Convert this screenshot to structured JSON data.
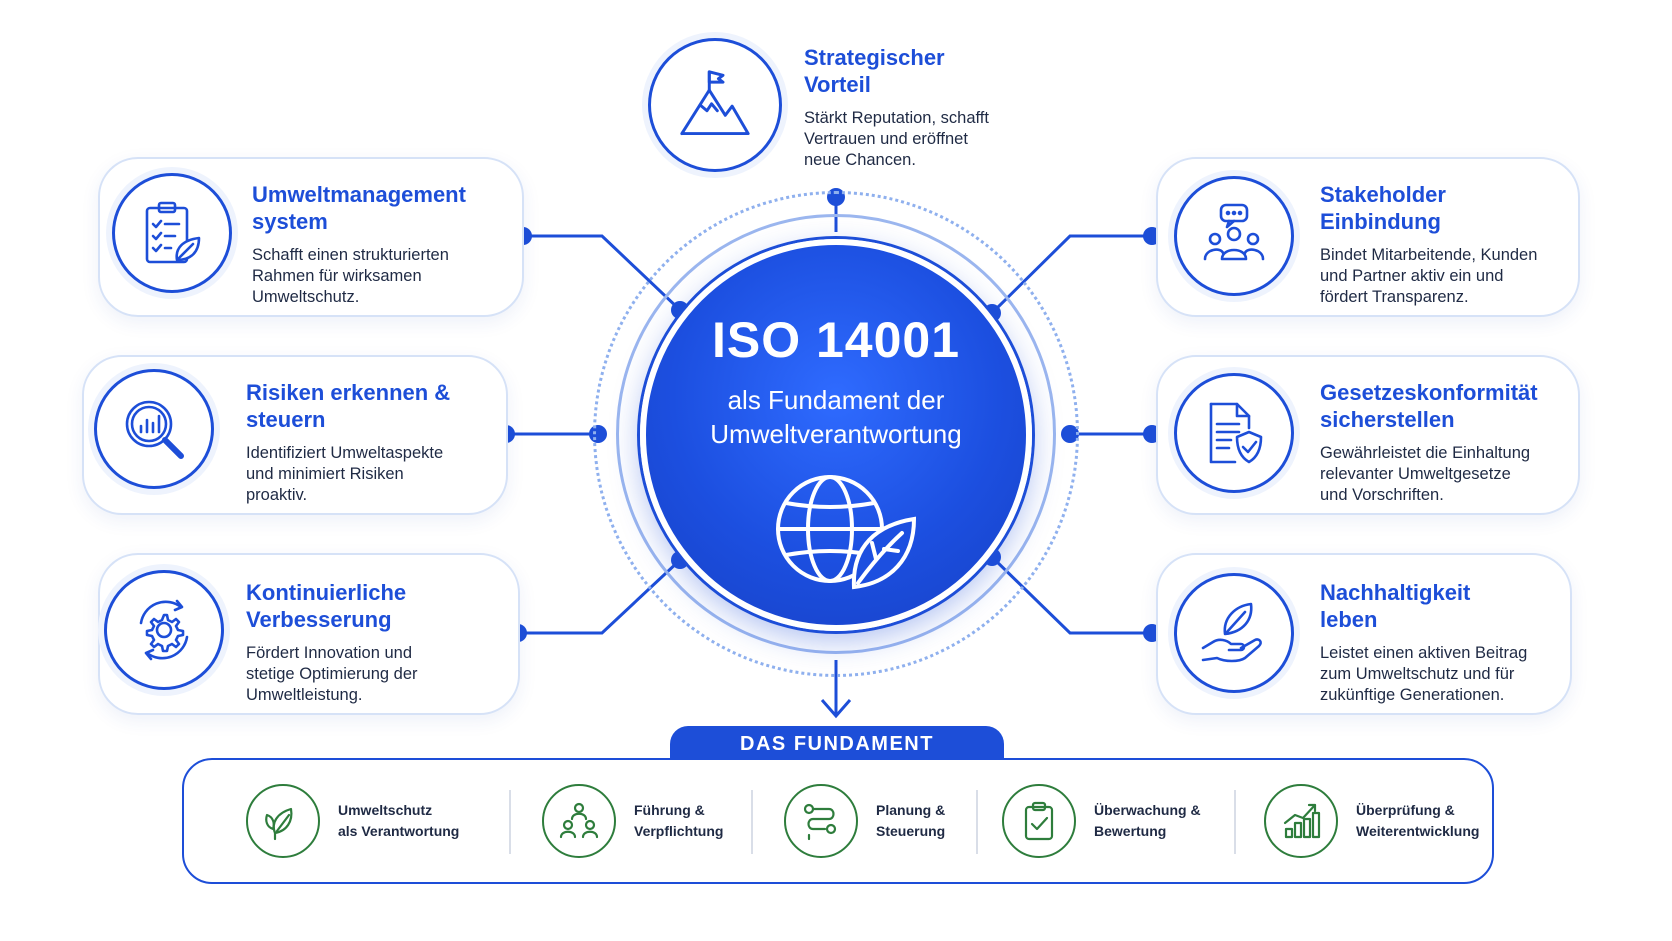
{
  "center": {
    "title": "ISO 14001",
    "subtitle": "als Fundament der\nUmweltverantwortung",
    "icon": "globe-leaf-icon"
  },
  "cards": {
    "strategic": {
      "title": "Strategischer\nVorteil",
      "desc": "Stärkt Reputation, schafft\nVertrauen und eröffnet\nneue Chancen.",
      "icon": "mountain-flag-icon"
    },
    "ems": {
      "title": "Umweltmanagement\nsystem",
      "desc": "Schafft einen strukturierten\nRahmen für wirksamen\nUmweltschutz.",
      "icon": "checklist-leaf-icon"
    },
    "risk": {
      "title": "Risiken erkennen &\nsteuern",
      "desc": "Identifiziert Umweltaspekte\nund minimiert Risiken\nproaktiv.",
      "icon": "magnifier-chart-icon"
    },
    "improvement": {
      "title": "Kontinuierliche\nVerbesserung",
      "desc": "Fördert Innovation und\nstetige Optimierung der\nUmweltleistung.",
      "icon": "gear-cycle-icon"
    },
    "stakeholder": {
      "title": "Stakeholder\nEinbindung",
      "desc": "Bindet Mitarbeitende, Kunden\nund Partner aktiv ein und\nfördert Transparenz.",
      "icon": "people-chat-icon"
    },
    "compliance": {
      "title": "Gesetzeskonformität\nsicherstellen",
      "desc": "Gewährleistet die Einhaltung\nrelevanter Umweltgesetze\nund Vorschriften.",
      "icon": "document-shield-icon"
    },
    "sustainability": {
      "title": "Nachhaltigkeit\nleben",
      "desc": "Leistet einen aktiven Beitrag\nzum Umweltschutz und für\nzukünftige Generationen.",
      "icon": "hand-leaf-icon"
    }
  },
  "foundation": {
    "label": "DAS FUNDAMENT",
    "items": [
      {
        "label": "Umweltschutz\nals Verantwortung",
        "icon": "leaves-icon"
      },
      {
        "label": "Führung &\nVerpflichtung",
        "icon": "team-icon"
      },
      {
        "label": "Planung &\nSteuerung",
        "icon": "route-icon"
      },
      {
        "label": "Überwachung &\nBewertung",
        "icon": "clipboard-check-icon"
      },
      {
        "label": "Überprüfung &\nWeiterentwicklung",
        "icon": "growth-chart-icon"
      }
    ]
  },
  "colors": {
    "primary": "#1d4ed8",
    "primary_light": "#9bb6ef",
    "card_border": "#d6e2f7",
    "green": "#2e7d3c",
    "text": "#1f2a44"
  }
}
